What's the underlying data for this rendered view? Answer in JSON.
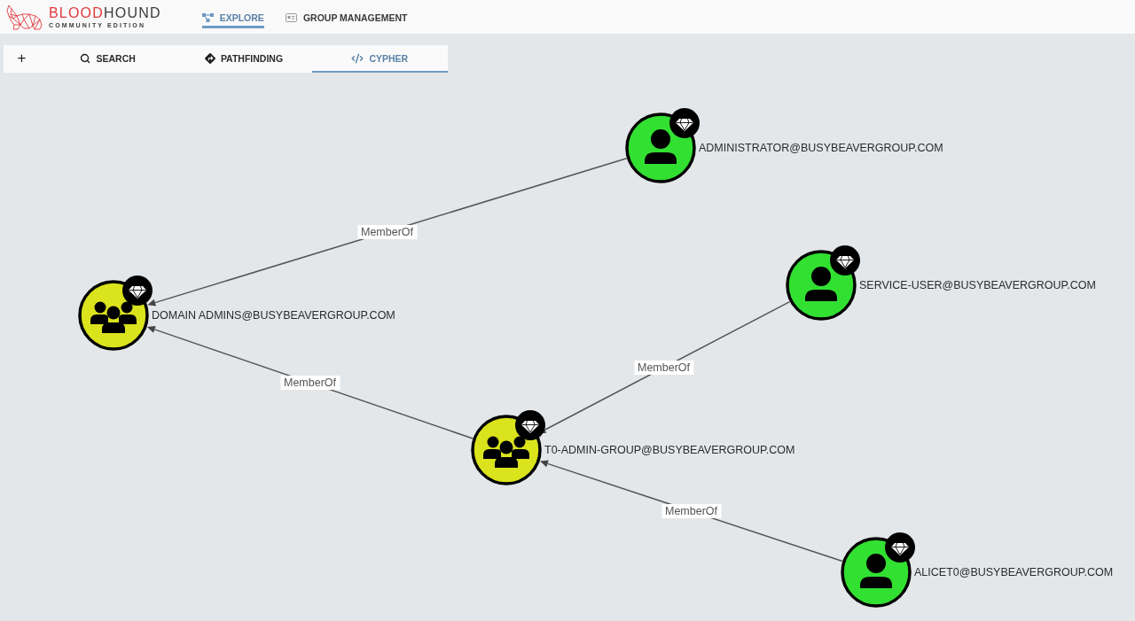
{
  "header": {
    "logo": {
      "wordmark": [
        {
          "text": "BLOOD",
          "color": "#e0393e"
        },
        {
          "text": "HOUND",
          "color": "#3b3b3b"
        }
      ],
      "subtitle": "COMMUNITY EDITION"
    },
    "nav": [
      {
        "kind": "explore",
        "label": "EXPLORE",
        "selected": true
      },
      {
        "kind": "management",
        "label": "GROUP MANAGEMENT",
        "selected": false
      }
    ]
  },
  "search_panel": {
    "add_tab": "+",
    "tabs": [
      {
        "kind": "search",
        "label": "SEARCH",
        "selected": false
      },
      {
        "kind": "pathfinding",
        "label": "PATHFINDING",
        "selected": false
      },
      {
        "kind": "cypher",
        "label": "CYPHER",
        "selected": true
      }
    ]
  },
  "graph": {
    "nodes": [
      {
        "kind": "user",
        "label": "ADMINISTRATOR@BUSYBEAVERGROUP.COM",
        "color": "#32e031",
        "high_value": true
      },
      {
        "kind": "group",
        "label": "DOMAIN ADMINS@BUSYBEAVERGROUP.COM",
        "color": "#dbe31c",
        "high_value": true
      },
      {
        "kind": "user",
        "label": "SERVICE-USER@BUSYBEAVERGROUP.COM",
        "color": "#32e031",
        "high_value": true
      },
      {
        "kind": "group",
        "label": "T0-ADMIN-GROUP@BUSYBEAVERGROUP.COM",
        "color": "#dbe31c",
        "high_value": true
      },
      {
        "kind": "user",
        "label": "ALICET0@BUSYBEAVERGROUP.COM",
        "color": "#32e031",
        "high_value": true
      }
    ],
    "edges": [
      {
        "label": "MemberOf"
      },
      {
        "label": "MemberOf"
      },
      {
        "label": "MemberOf"
      },
      {
        "label": "MemberOf"
      }
    ]
  }
}
